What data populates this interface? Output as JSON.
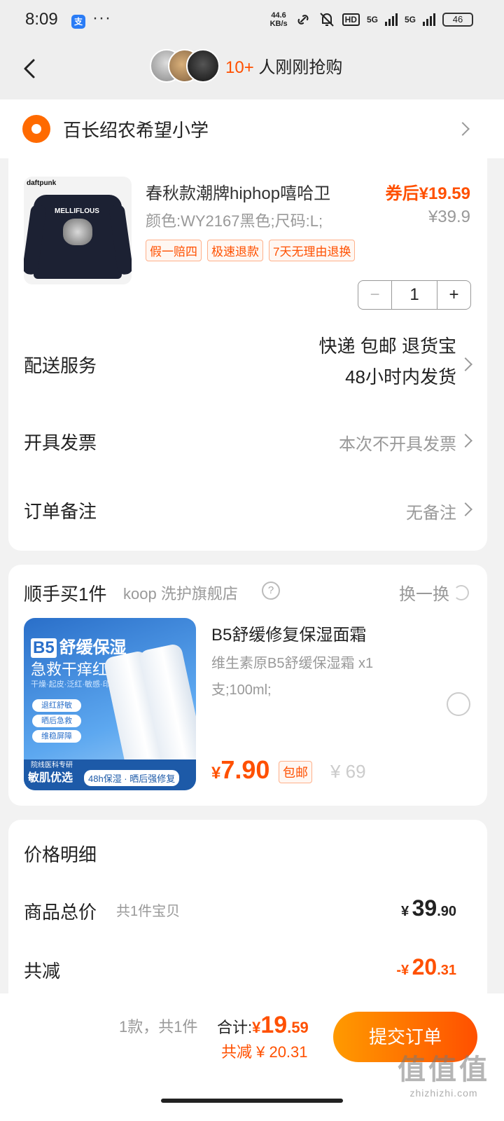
{
  "status_bar": {
    "time": "8:09",
    "app_icon_text": "支",
    "dots": "···",
    "speed_value": "44.6",
    "speed_unit": "KB/s",
    "hd": "HD",
    "sig1": "5G",
    "sig2": "5G",
    "battery": "46"
  },
  "header": {
    "buy_count_prefix": "10+",
    "buy_count_text": " 人刚刚抢购"
  },
  "address": {
    "text": "百长绍农希望小学"
  },
  "product": {
    "title": "春秋款潮牌hiphop嘻哈卫",
    "price": "券后¥19.59",
    "spec": "颜色:WY2167黑色;尺码:L;",
    "original_price": "¥39.9",
    "tags": [
      "假一赔四",
      "极速退款",
      "7天无理由退换"
    ],
    "quantity": "1",
    "minus": "−",
    "plus": "+",
    "image_brand": "daftpunk",
    "image_text": "MELLIFLOUS"
  },
  "rows": {
    "shipping_label": "配送服务",
    "shipping_value_1": "快递 包邮 退货宝",
    "shipping_value_2": "48小时内发货",
    "invoice_label": "开具发票",
    "invoice_value": "本次不开具发票",
    "note_label": "订单备注",
    "note_value": "无备注"
  },
  "addon": {
    "title": "顺手买1件",
    "shop": "koop 洗护旗舰店",
    "help": "?",
    "swap": "换一换",
    "name": "B5舒缓修复保湿面霜",
    "spec": "维生素原B5舒缓保湿霜 x1支;100ml;",
    "price_symbol": "¥",
    "price": "7.90",
    "free_shipping": "包邮",
    "original_price": "¥ 69",
    "image": {
      "badge": "B5",
      "headline": "舒缓保湿",
      "sub": "急救干痒红",
      "tagline": "干燥·起皮·泛红·敏感·印痕",
      "pills": [
        "退红舒敏",
        "晒后急救",
        "维稳屏障"
      ],
      "foot_a": "敏肌优选",
      "foot_b": "48h保湿 · 晒后强修复",
      "foot_top": "院线医科专研"
    }
  },
  "price_detail": {
    "title": "价格明细",
    "goods_total_label": "商品总价",
    "goods_total_sub": "共1件宝贝",
    "goods_total_symbol": "¥",
    "goods_total_int": "39",
    "goods_total_dec": ".90",
    "reduce_label": "共减",
    "reduce_symbol": "-¥",
    "reduce_int": "20",
    "reduce_dec": ".31"
  },
  "bottom_bar": {
    "count": "1款，共1件",
    "total_label": "合计:",
    "total_symbol": "¥",
    "total_int": "19",
    "total_dec": ".59",
    "reduce": "共减 ¥ 20.31",
    "submit": "提交订单",
    "watermark_main": "值值值",
    "watermark_sub": "zhizhizhi.com"
  },
  "colors": {
    "accent": "#ff5000",
    "accent_light": "#ff9a00",
    "page_bg": "#f2f2f2"
  }
}
